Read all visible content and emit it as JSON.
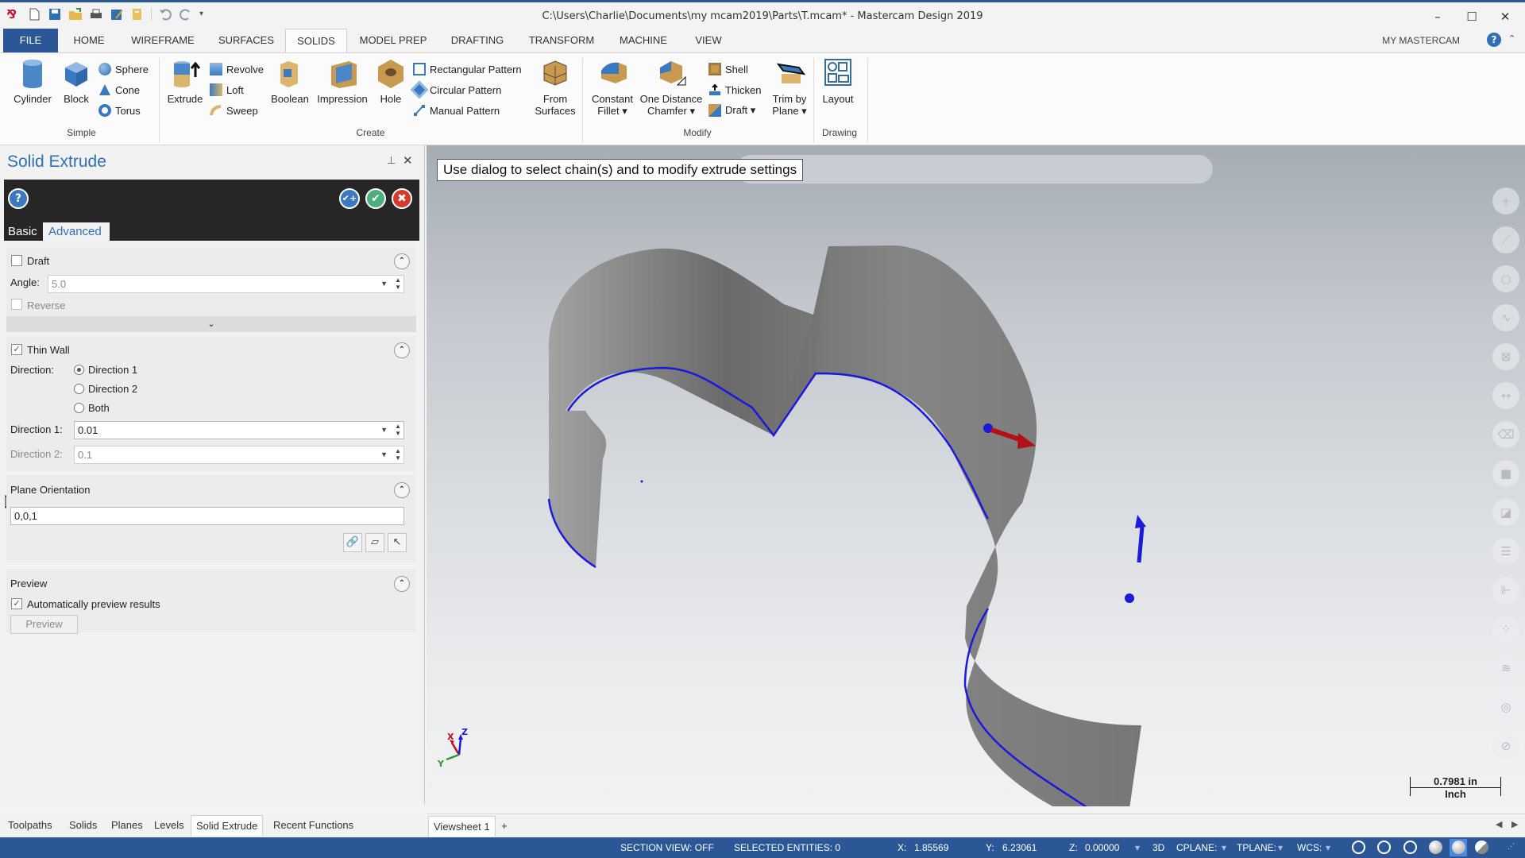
{
  "window": {
    "title": "C:\\Users\\Charlie\\Documents\\my mcam2019\\Parts\\T.mcam* - Mastercam Design 2019",
    "app_logo": "mastercam-19-logo",
    "controls": {
      "minimize": "–",
      "maximize": "☐",
      "close": "✕"
    }
  },
  "quick_access": [
    "new-file-icon",
    "save-icon",
    "open-icon",
    "print-icon",
    "save-as-icon",
    "open-folder-icon",
    "undo-icon",
    "redo-icon",
    "customize-icon"
  ],
  "ribbon_tabs": [
    {
      "label": "FILE"
    },
    {
      "label": "HOME"
    },
    {
      "label": "WIREFRAME"
    },
    {
      "label": "SURFACES"
    },
    {
      "label": "SOLIDS",
      "active": true
    },
    {
      "label": "MODEL PREP"
    },
    {
      "label": "DRAFTING"
    },
    {
      "label": "TRANSFORM"
    },
    {
      "label": "MACHINE"
    },
    {
      "label": "VIEW"
    }
  ],
  "my_mastercam": "MY MASTERCAM",
  "ribbon": {
    "groups": {
      "simple": "Simple",
      "create": "Create",
      "modify": "Modify",
      "drawing": "Drawing"
    },
    "simple": {
      "cylinder": "Cylinder",
      "block": "Block",
      "sphere": "Sphere",
      "cone": "Cone",
      "torus": "Torus"
    },
    "create": {
      "extrude": "Extrude",
      "revolve": "Revolve",
      "loft": "Loft",
      "sweep": "Sweep",
      "boolean": "Boolean",
      "impression": "Impression",
      "hole": "Hole",
      "rect_pattern": "Rectangular Pattern",
      "circ_pattern": "Circular Pattern",
      "manual_pattern": "Manual Pattern",
      "from_surfaces_1": "From",
      "from_surfaces_2": "Surfaces"
    },
    "modify": {
      "fillet_1": "Constant",
      "fillet_2": "Fillet ▾",
      "chamfer_1": "One Distance",
      "chamfer_2": "Chamfer ▾",
      "shell": "Shell",
      "thicken": "Thicken",
      "draft": "Draft ▾",
      "trim_1": "Trim by",
      "trim_2": "Plane ▾"
    },
    "drawing": {
      "layout": "Layout"
    }
  },
  "panel": {
    "title": "Solid Extrude",
    "pin": "📌",
    "close": "✕",
    "tabs": {
      "basic": "Basic",
      "advanced": "Advanced",
      "active": "Advanced"
    },
    "draft": {
      "label": "Draft",
      "checked": false,
      "angle_label": "Angle:",
      "angle_value": "5.0",
      "reverse_label": "Reverse",
      "reverse_checked": false
    },
    "thin_wall": {
      "label": "Thin Wall",
      "checked": true,
      "direction_label": "Direction:",
      "options": [
        "Direction 1",
        "Direction 2",
        "Both"
      ],
      "selected": "Direction 1",
      "dir1_label": "Direction 1:",
      "dir1_value": "0.01",
      "dir2_label": "Direction 2:",
      "dir2_value": "0.1"
    },
    "plane": {
      "label": "Plane Orientation",
      "value": "0,0,1"
    },
    "preview": {
      "label": "Preview",
      "auto_label": "Automatically preview results",
      "auto_checked": true,
      "button": "Preview"
    }
  },
  "bottom_tabs": [
    {
      "label": "Toolpaths"
    },
    {
      "label": "Solids"
    },
    {
      "label": "Planes"
    },
    {
      "label": "Levels"
    },
    {
      "label": "Solid Extrude",
      "active": true
    },
    {
      "label": "Recent Functions"
    }
  ],
  "viewport": {
    "hint": "Use dialog to select chain(s) and to modify extrude settings",
    "scale_value": "0.7981 in",
    "scale_unit": "Inch",
    "axes": {
      "x": "X",
      "y": "Y",
      "z": "Z"
    },
    "right_toolbar": [
      "add-point-icon",
      "line-icon",
      "circle-icon",
      "spline-icon",
      "box-view-icon",
      "dimension-icon",
      "eraser-icon",
      "solid-icon",
      "analyze-icon",
      "levels-icon",
      "plane-icon",
      "colors-icon",
      "layers-icon",
      "chain-icon",
      "no-icon"
    ]
  },
  "viewsheet": {
    "tab": "Viewsheet 1",
    "add": "+"
  },
  "status": {
    "section_view": "SECTION VIEW: OFF",
    "selected": "SELECTED ENTITIES: 0",
    "x_label": "X:",
    "x": "1.85569",
    "y_label": "Y:",
    "y": "6.23061",
    "z_label": "Z:",
    "z": "0.00000",
    "mode": "3D",
    "cplane": "CPLANE:",
    "tplane": "TPLANE:",
    "wcs": "WCS:"
  },
  "colors": {
    "accent": "#2b5797",
    "panel_title": "#2f6fb4",
    "chain": "#1a1adb",
    "direction_arrow": "#c0101a"
  }
}
